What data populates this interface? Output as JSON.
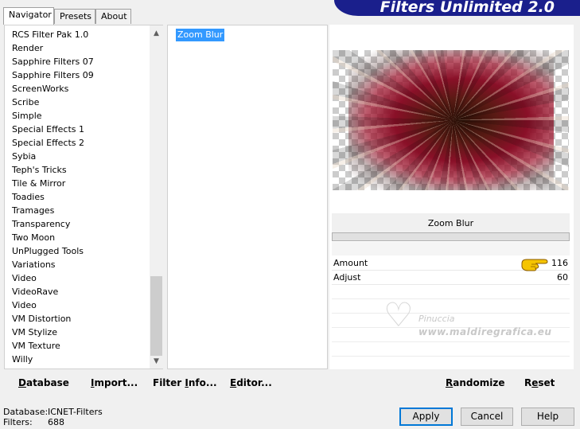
{
  "window": {
    "banner_title": "Filters Unlimited 2.0"
  },
  "tabs": [
    {
      "label": "Navigator",
      "active": true
    },
    {
      "label": "Presets",
      "active": false
    },
    {
      "label": "About",
      "active": false
    }
  ],
  "categories": [
    "RCS Filter Pak 1.0",
    "Render",
    "Sapphire Filters 07",
    "Sapphire Filters 09",
    "ScreenWorks",
    "Scribe",
    "Simple",
    "Special Effects 1",
    "Special Effects 2",
    "Sybia",
    "Teph's Tricks",
    "Tile & Mirror",
    "Toadies",
    "Tramages",
    "Transparency",
    "Two Moon",
    "UnPlugged Tools",
    "Variations",
    "Video",
    "VideoRave",
    "Video",
    "VM Distortion",
    "VM Stylize",
    "VM Texture",
    "Willy"
  ],
  "filters": {
    "selected": "Zoom Blur"
  },
  "filter_panel": {
    "title": "Zoom Blur",
    "params": [
      {
        "label": "Amount",
        "value": "116"
      },
      {
        "label": "Adjust",
        "value": "60"
      }
    ]
  },
  "watermark": {
    "line1": "Pinuccia",
    "line2": "www.maldiregrafica.eu"
  },
  "bottom_left": {
    "database": {
      "ul": "D",
      "rest": "atabase"
    },
    "import": {
      "ul": "I",
      "rest": "mport..."
    },
    "filter_info": {
      "pre": "Filter ",
      "ul": "I",
      "rest": "nfo..."
    },
    "editor": {
      "ul": "E",
      "rest": "ditor..."
    }
  },
  "bottom_right": {
    "randomize": {
      "ul": "R",
      "rest": "andomize"
    },
    "reset": {
      "pre": "R",
      "ul": "e",
      "rest": "set"
    }
  },
  "status": {
    "database_label": "Database:",
    "database_value": "ICNET-Filters",
    "filters_label": "Filters:",
    "filters_value": "688"
  },
  "buttons": {
    "apply": "Apply",
    "cancel": "Cancel",
    "help": "Help"
  },
  "colors": {
    "banner": "#1a1f8c",
    "selection": "#3399ff",
    "default_button_border": "#0078d7"
  }
}
